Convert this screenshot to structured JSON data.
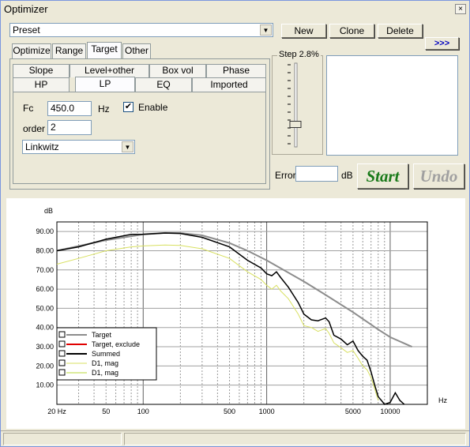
{
  "window": {
    "title": "Optimizer",
    "close_glyph": "×"
  },
  "preset": {
    "value": "Preset"
  },
  "toolbar": {
    "new_label": "New",
    "clone_label": "Clone",
    "delete_label": "Delete",
    "expand_label": ">>>"
  },
  "main_tabs": [
    "Optimize",
    "Range",
    "Target",
    "Other"
  ],
  "sub_tabs_row1": [
    "Slope",
    "Level+other",
    "Box vol",
    "Phase"
  ],
  "sub_tabs_row2": [
    "HP",
    "LP",
    "EQ",
    "Imported"
  ],
  "lp": {
    "fc_label": "Fc",
    "fc_value": "450.0",
    "fc_unit": "Hz",
    "enable_label": "Enable",
    "enable_checked": true,
    "order_label": "order",
    "order_value": "2",
    "type_value": "Linkwitz"
  },
  "step": {
    "label": "Step 2.8%",
    "level": 0.75
  },
  "error": {
    "label": "Error",
    "value": "",
    "unit": "dB"
  },
  "actions": {
    "start_label": "Start",
    "undo_label": "Undo"
  },
  "colors": {
    "start": "#1a7a1a",
    "undo": "#a0a0a0",
    "target": "#8c8c8c",
    "target_exclude": "#e00000",
    "summed": "#000000",
    "d1a": "#d8e060",
    "d1b": "#b8d838"
  },
  "chart_data": {
    "type": "line",
    "ylabel": "dB",
    "xlabel": "Hz",
    "xscale": "log",
    "xlim": [
      20,
      20000
    ],
    "ylim": [
      0,
      95
    ],
    "yticks": [
      "90.00",
      "80.00",
      "70.00",
      "60.00",
      "50.00",
      "40.00",
      "30.00",
      "20.00",
      "10.00"
    ],
    "ytick_values": [
      90,
      80,
      70,
      60,
      50,
      40,
      30,
      20,
      10
    ],
    "xticks": [
      "20 Hz",
      "50",
      "100",
      "500",
      "1000",
      "5000",
      "10000"
    ],
    "xtick_values": [
      20,
      50,
      100,
      500,
      1000,
      5000,
      10000
    ],
    "series": [
      {
        "name": "Target",
        "x": [
          20,
          50,
          100,
          150,
          200,
          300,
          500,
          700,
          1000,
          2000,
          3000,
          5000,
          8000,
          10000,
          15000
        ],
        "y": [
          80,
          85.5,
          88.5,
          89.3,
          89.2,
          88,
          84,
          80,
          75,
          64,
          57,
          48,
          39,
          35,
          30
        ]
      },
      {
        "name": "Target, exclude",
        "x": [],
        "y": []
      },
      {
        "name": "Summed",
        "x": [
          20,
          30,
          50,
          80,
          100,
          150,
          200,
          300,
          500,
          700,
          900,
          1000,
          1100,
          1200,
          1300,
          1500,
          1800,
          2000,
          2300,
          2600,
          3000,
          3200,
          3500,
          4000,
          4500,
          5000,
          5500,
          6000,
          6500,
          7000,
          7500,
          8000,
          8500,
          9000,
          10000,
          11000,
          12000,
          13000
        ],
        "y": [
          80,
          82,
          86,
          88.5,
          88.6,
          89.2,
          89,
          87,
          82,
          75,
          71,
          68,
          67,
          69,
          66,
          61,
          53,
          47,
          44,
          43.5,
          45,
          43,
          36,
          34,
          31,
          33,
          28,
          25,
          23,
          17,
          10,
          4,
          2,
          0,
          1,
          6,
          2,
          0
        ]
      },
      {
        "name": "D1, mag",
        "x": [
          20,
          30,
          50,
          80,
          100,
          150,
          200,
          300,
          500,
          700,
          900,
          1000,
          1100,
          1200,
          1300,
          1500,
          1800,
          2000,
          2300,
          2600,
          3000,
          3200,
          3500,
          4000,
          4500,
          5000,
          5500,
          6000,
          6500,
          7000,
          7500,
          8000
        ],
        "y": [
          73,
          76,
          80,
          82,
          82.5,
          83,
          82.8,
          81,
          76,
          69,
          65,
          62,
          60,
          62,
          59,
          55,
          47,
          41,
          40,
          38,
          39.5,
          37,
          32,
          29.5,
          27,
          28,
          24,
          20,
          18,
          14,
          8,
          2
        ]
      },
      {
        "name": "D1, mag",
        "x": [],
        "y": []
      }
    ],
    "legend_position": "bottom-left",
    "grid": true
  },
  "status": {
    "left": "",
    "right": ""
  }
}
